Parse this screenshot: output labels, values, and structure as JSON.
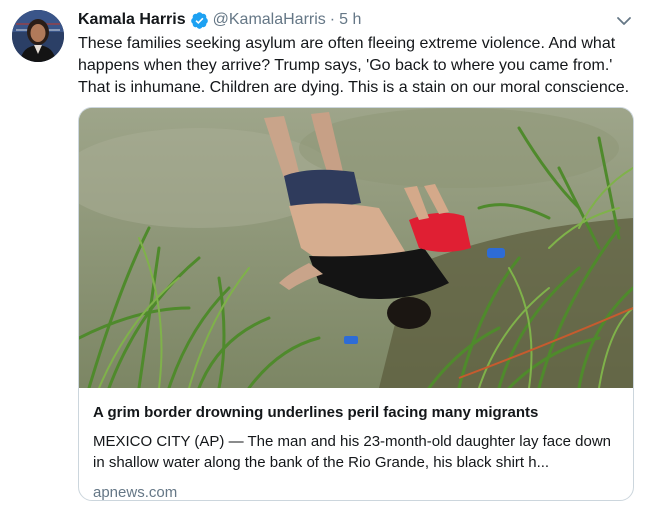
{
  "author": {
    "name": "Kamala Harris",
    "handle": "@KamalaHarris",
    "separator": "·",
    "time": "5 h",
    "verified_color": "#1da1f2"
  },
  "tweet": {
    "text": "These families seeking asylum are often fleeing extreme violence. And what happens when they arrive? Trump says, 'Go back to where you came from.' That is inhumane. Children are dying. This is a stain on our moral conscience."
  },
  "card": {
    "title": "A grim border drowning underlines peril facing many migrants",
    "description": "MEXICO CITY (AP) — The man and his 23-month-old daughter lay face down in shallow water along the bank of the Rio Grande, his black shirt h...",
    "domain": "apnews.com"
  },
  "icons": {
    "verified": "verified-badge-icon",
    "caret": "chevron-down-icon"
  },
  "colors": {
    "text": "#14171a",
    "secondary": "#657786",
    "border": "#ccd6dd",
    "accent": "#1da1f2"
  }
}
